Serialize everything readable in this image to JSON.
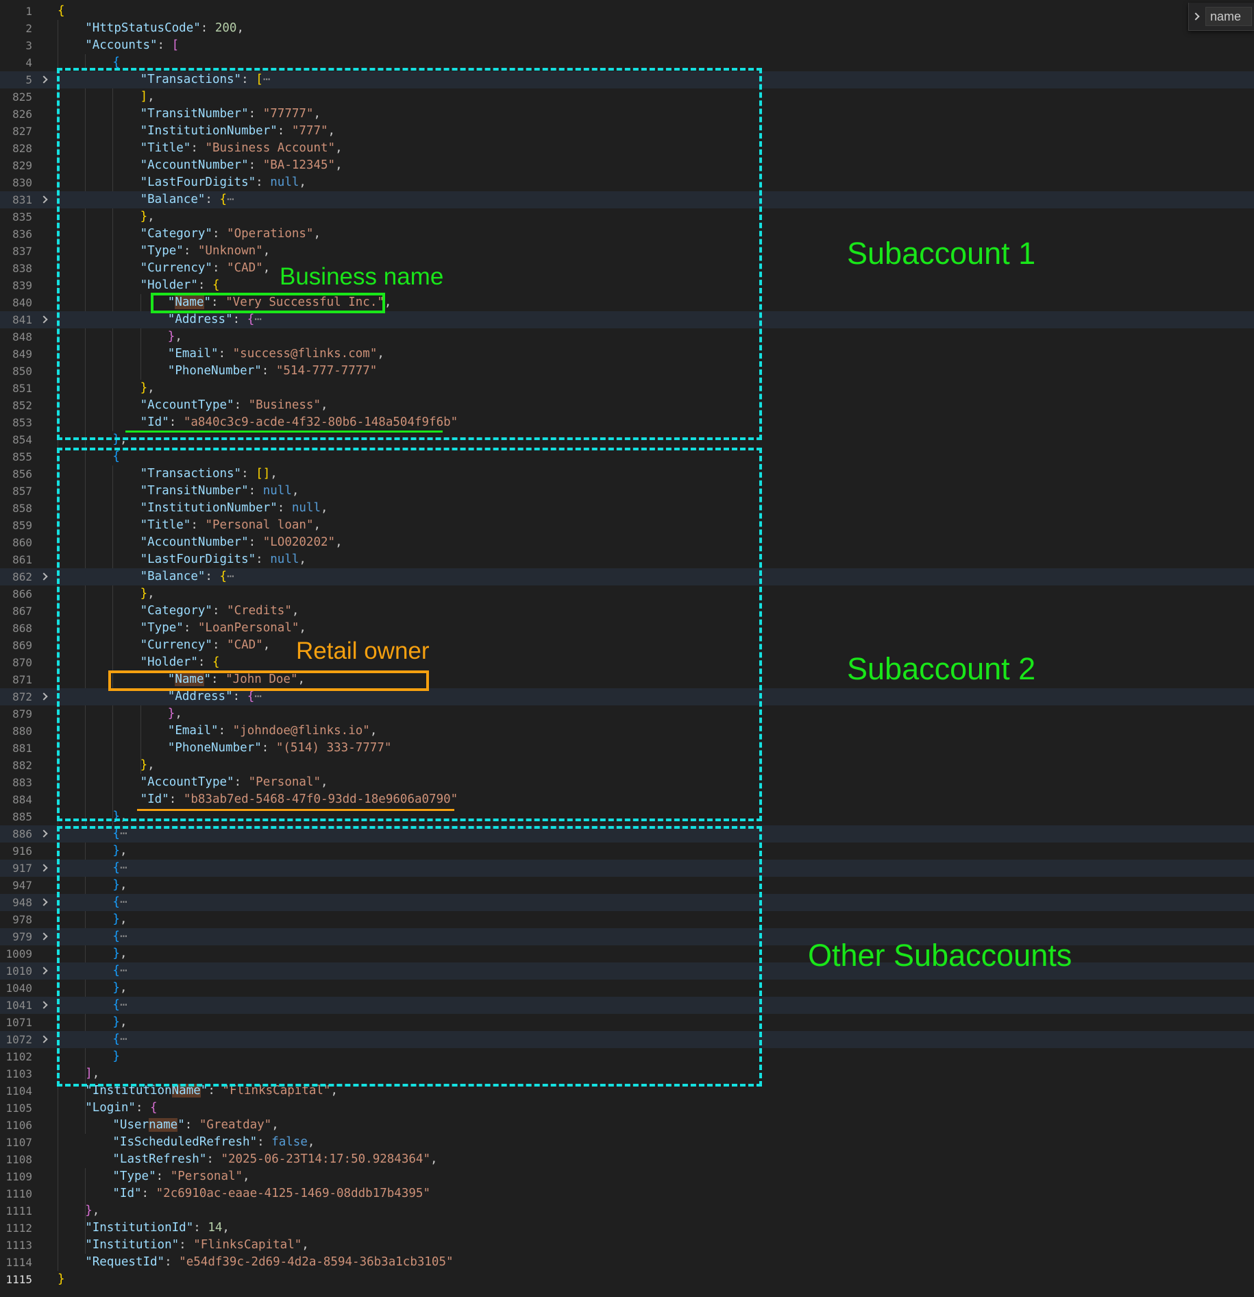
{
  "find_widget": {
    "query": "name"
  },
  "annotations": {
    "subaccount_1": "Subaccount 1",
    "subaccount_2": "Subaccount 2",
    "other_subaccounts": "Other Subaccounts",
    "business_name": "Business name",
    "retail_owner": "Retail owner"
  },
  "annotation_colors": {
    "green": "#19e619",
    "orange": "#f5a010",
    "cyan_dashed": "#14e0e0"
  },
  "current_line": "1115",
  "lines": [
    {
      "n": "1",
      "ind": 0,
      "t": [
        [
          "{",
          "br1"
        ]
      ]
    },
    {
      "n": "2",
      "ind": 1,
      "t": [
        [
          "\"HttpStatusCode\"",
          "k"
        ],
        [
          ": ",
          "p"
        ],
        [
          "200",
          "n"
        ],
        [
          ",",
          "p"
        ]
      ]
    },
    {
      "n": "3",
      "ind": 1,
      "t": [
        [
          "\"Accounts\"",
          "k"
        ],
        [
          ": ",
          "p"
        ],
        [
          "[",
          "br2"
        ]
      ]
    },
    {
      "n": "4",
      "ind": 2,
      "t": [
        [
          "{",
          "br3"
        ]
      ]
    },
    {
      "n": "5",
      "ind": 3,
      "f": true,
      "t": [
        [
          "\"Transactions\"",
          "k"
        ],
        [
          ": ",
          "p"
        ],
        [
          "[",
          "br1"
        ],
        [
          "⋯",
          "e"
        ]
      ]
    },
    {
      "n": "825",
      "ind": 3,
      "t": [
        [
          "]",
          "br1"
        ],
        [
          ",",
          "p"
        ]
      ]
    },
    {
      "n": "826",
      "ind": 3,
      "t": [
        [
          "\"TransitNumber\"",
          "k"
        ],
        [
          ": ",
          "p"
        ],
        [
          "\"77777\"",
          "s"
        ],
        [
          ",",
          "p"
        ]
      ]
    },
    {
      "n": "827",
      "ind": 3,
      "t": [
        [
          "\"InstitutionNumber\"",
          "k"
        ],
        [
          ": ",
          "p"
        ],
        [
          "\"777\"",
          "s"
        ],
        [
          ",",
          "p"
        ]
      ]
    },
    {
      "n": "828",
      "ind": 3,
      "t": [
        [
          "\"Title\"",
          "k"
        ],
        [
          ": ",
          "p"
        ],
        [
          "\"Business Account\"",
          "s"
        ],
        [
          ",",
          "p"
        ]
      ]
    },
    {
      "n": "829",
      "ind": 3,
      "t": [
        [
          "\"AccountNumber\"",
          "k"
        ],
        [
          ": ",
          "p"
        ],
        [
          "\"BA-12345\"",
          "s"
        ],
        [
          ",",
          "p"
        ]
      ]
    },
    {
      "n": "830",
      "ind": 3,
      "t": [
        [
          "\"LastFourDigits\"",
          "k"
        ],
        [
          ": ",
          "p"
        ],
        [
          "null",
          "b"
        ],
        [
          ",",
          "p"
        ]
      ]
    },
    {
      "n": "831",
      "ind": 3,
      "f": true,
      "t": [
        [
          "\"Balance\"",
          "k"
        ],
        [
          ": ",
          "p"
        ],
        [
          "{",
          "br1"
        ],
        [
          "⋯",
          "e"
        ]
      ]
    },
    {
      "n": "835",
      "ind": 3,
      "t": [
        [
          "}",
          "br1"
        ],
        [
          ",",
          "p"
        ]
      ]
    },
    {
      "n": "836",
      "ind": 3,
      "t": [
        [
          "\"Category\"",
          "k"
        ],
        [
          ": ",
          "p"
        ],
        [
          "\"Operations\"",
          "s"
        ],
        [
          ",",
          "p"
        ]
      ]
    },
    {
      "n": "837",
      "ind": 3,
      "t": [
        [
          "\"Type\"",
          "k"
        ],
        [
          ": ",
          "p"
        ],
        [
          "\"Unknown\"",
          "s"
        ],
        [
          ",",
          "p"
        ]
      ]
    },
    {
      "n": "838",
      "ind": 3,
      "t": [
        [
          "\"Currency\"",
          "k"
        ],
        [
          ": ",
          "p"
        ],
        [
          "\"CAD\"",
          "s"
        ],
        [
          ",",
          "p"
        ]
      ]
    },
    {
      "n": "839",
      "ind": 3,
      "t": [
        [
          "\"Holder\"",
          "k"
        ],
        [
          ": ",
          "p"
        ],
        [
          "{",
          "br1"
        ]
      ]
    },
    {
      "n": "840",
      "ind": 4,
      "t": [
        [
          "\"",
          "k"
        ],
        [
          "Name",
          "kh"
        ],
        [
          "\"",
          "k"
        ],
        [
          ": ",
          "p"
        ],
        [
          "\"Very Successful Inc.\"",
          "s"
        ],
        [
          ",",
          "p"
        ]
      ]
    },
    {
      "n": "841",
      "ind": 4,
      "f": true,
      "t": [
        [
          "\"Address\"",
          "k"
        ],
        [
          ": ",
          "p"
        ],
        [
          "{",
          "br2"
        ],
        [
          "⋯",
          "e"
        ]
      ]
    },
    {
      "n": "848",
      "ind": 4,
      "t": [
        [
          "}",
          "br2"
        ],
        [
          ",",
          "p"
        ]
      ]
    },
    {
      "n": "849",
      "ind": 4,
      "t": [
        [
          "\"Email\"",
          "k"
        ],
        [
          ": ",
          "p"
        ],
        [
          "\"success@flinks.com\"",
          "s"
        ],
        [
          ",",
          "p"
        ]
      ]
    },
    {
      "n": "850",
      "ind": 4,
      "t": [
        [
          "\"PhoneNumber\"",
          "k"
        ],
        [
          ": ",
          "p"
        ],
        [
          "\"514-777-7777\"",
          "s"
        ]
      ]
    },
    {
      "n": "851",
      "ind": 3,
      "t": [
        [
          "}",
          "br1"
        ],
        [
          ",",
          "p"
        ]
      ]
    },
    {
      "n": "852",
      "ind": 3,
      "t": [
        [
          "\"AccountType\"",
          "k"
        ],
        [
          ": ",
          "p"
        ],
        [
          "\"Business\"",
          "s"
        ],
        [
          ",",
          "p"
        ]
      ]
    },
    {
      "n": "853",
      "ind": 3,
      "t": [
        [
          "\"Id\"",
          "k"
        ],
        [
          ": ",
          "p"
        ],
        [
          "\"a840c3c9-acde-4f32-80b6-148a504f9f6b\"",
          "s"
        ]
      ]
    },
    {
      "n": "854",
      "ind": 2,
      "t": [
        [
          "}",
          "br3"
        ],
        [
          ",",
          "p"
        ]
      ]
    },
    {
      "n": "855",
      "ind": 2,
      "t": [
        [
          "{",
          "br3"
        ]
      ]
    },
    {
      "n": "856",
      "ind": 3,
      "t": [
        [
          "\"Transactions\"",
          "k"
        ],
        [
          ": ",
          "p"
        ],
        [
          "[]",
          "br1"
        ],
        [
          ",",
          "p"
        ]
      ]
    },
    {
      "n": "857",
      "ind": 3,
      "t": [
        [
          "\"TransitNumber\"",
          "k"
        ],
        [
          ": ",
          "p"
        ],
        [
          "null",
          "b"
        ],
        [
          ",",
          "p"
        ]
      ]
    },
    {
      "n": "858",
      "ind": 3,
      "t": [
        [
          "\"InstitutionNumber\"",
          "k"
        ],
        [
          ": ",
          "p"
        ],
        [
          "null",
          "b"
        ],
        [
          ",",
          "p"
        ]
      ]
    },
    {
      "n": "859",
      "ind": 3,
      "t": [
        [
          "\"Title\"",
          "k"
        ],
        [
          ": ",
          "p"
        ],
        [
          "\"Personal loan\"",
          "s"
        ],
        [
          ",",
          "p"
        ]
      ]
    },
    {
      "n": "860",
      "ind": 3,
      "t": [
        [
          "\"AccountNumber\"",
          "k"
        ],
        [
          ": ",
          "p"
        ],
        [
          "\"LO020202\"",
          "s"
        ],
        [
          ",",
          "p"
        ]
      ]
    },
    {
      "n": "861",
      "ind": 3,
      "t": [
        [
          "\"LastFourDigits\"",
          "k"
        ],
        [
          ": ",
          "p"
        ],
        [
          "null",
          "b"
        ],
        [
          ",",
          "p"
        ]
      ]
    },
    {
      "n": "862",
      "ind": 3,
      "f": true,
      "t": [
        [
          "\"Balance\"",
          "k"
        ],
        [
          ": ",
          "p"
        ],
        [
          "{",
          "br1"
        ],
        [
          "⋯",
          "e"
        ]
      ]
    },
    {
      "n": "866",
      "ind": 3,
      "t": [
        [
          "}",
          "br1"
        ],
        [
          ",",
          "p"
        ]
      ]
    },
    {
      "n": "867",
      "ind": 3,
      "t": [
        [
          "\"Category\"",
          "k"
        ],
        [
          ": ",
          "p"
        ],
        [
          "\"Credits\"",
          "s"
        ],
        [
          ",",
          "p"
        ]
      ]
    },
    {
      "n": "868",
      "ind": 3,
      "t": [
        [
          "\"Type\"",
          "k"
        ],
        [
          ": ",
          "p"
        ],
        [
          "\"LoanPersonal\"",
          "s"
        ],
        [
          ",",
          "p"
        ]
      ]
    },
    {
      "n": "869",
      "ind": 3,
      "t": [
        [
          "\"Currency\"",
          "k"
        ],
        [
          ": ",
          "p"
        ],
        [
          "\"CAD\"",
          "s"
        ],
        [
          ",",
          "p"
        ]
      ]
    },
    {
      "n": "870",
      "ind": 3,
      "t": [
        [
          "\"Holder\"",
          "k"
        ],
        [
          ": ",
          "p"
        ],
        [
          "{",
          "br1"
        ]
      ]
    },
    {
      "n": "871",
      "ind": 4,
      "t": [
        [
          "\"",
          "k"
        ],
        [
          "Name",
          "kh"
        ],
        [
          "\"",
          "k"
        ],
        [
          ": ",
          "p"
        ],
        [
          "\"John Doe\"",
          "s"
        ],
        [
          ",",
          "p"
        ]
      ]
    },
    {
      "n": "872",
      "ind": 4,
      "f": true,
      "t": [
        [
          "\"Address\"",
          "k"
        ],
        [
          ": ",
          "p"
        ],
        [
          "{",
          "br2"
        ],
        [
          "⋯",
          "e"
        ]
      ]
    },
    {
      "n": "879",
      "ind": 4,
      "t": [
        [
          "}",
          "br2"
        ],
        [
          ",",
          "p"
        ]
      ]
    },
    {
      "n": "880",
      "ind": 4,
      "t": [
        [
          "\"Email\"",
          "k"
        ],
        [
          ": ",
          "p"
        ],
        [
          "\"johndoe@flinks.io\"",
          "s"
        ],
        [
          ",",
          "p"
        ]
      ]
    },
    {
      "n": "881",
      "ind": 4,
      "t": [
        [
          "\"PhoneNumber\"",
          "k"
        ],
        [
          ": ",
          "p"
        ],
        [
          "\"(514) 333-7777\"",
          "s"
        ]
      ]
    },
    {
      "n": "882",
      "ind": 3,
      "t": [
        [
          "}",
          "br1"
        ],
        [
          ",",
          "p"
        ]
      ]
    },
    {
      "n": "883",
      "ind": 3,
      "t": [
        [
          "\"AccountType\"",
          "k"
        ],
        [
          ": ",
          "p"
        ],
        [
          "\"Personal\"",
          "s"
        ],
        [
          ",",
          "p"
        ]
      ]
    },
    {
      "n": "884",
      "ind": 3,
      "t": [
        [
          "\"Id\"",
          "k"
        ],
        [
          ": ",
          "p"
        ],
        [
          "\"b83ab7ed-5468-47f0-93dd-18e9606a0790\"",
          "s"
        ]
      ]
    },
    {
      "n": "885",
      "ind": 2,
      "t": [
        [
          "}",
          "br3"
        ],
        [
          ",",
          "p"
        ]
      ]
    },
    {
      "n": "886",
      "ind": 2,
      "f": true,
      "t": [
        [
          "{",
          "br3"
        ],
        [
          "⋯",
          "e"
        ]
      ]
    },
    {
      "n": "916",
      "ind": 2,
      "t": [
        [
          "}",
          "br3"
        ],
        [
          ",",
          "p"
        ]
      ]
    },
    {
      "n": "917",
      "ind": 2,
      "f": true,
      "t": [
        [
          "{",
          "br3"
        ],
        [
          "⋯",
          "e"
        ]
      ]
    },
    {
      "n": "947",
      "ind": 2,
      "t": [
        [
          "}",
          "br3"
        ],
        [
          ",",
          "p"
        ]
      ]
    },
    {
      "n": "948",
      "ind": 2,
      "f": true,
      "t": [
        [
          "{",
          "br3"
        ],
        [
          "⋯",
          "e"
        ]
      ]
    },
    {
      "n": "978",
      "ind": 2,
      "t": [
        [
          "}",
          "br3"
        ],
        [
          ",",
          "p"
        ]
      ]
    },
    {
      "n": "979",
      "ind": 2,
      "f": true,
      "t": [
        [
          "{",
          "br3"
        ],
        [
          "⋯",
          "e"
        ]
      ]
    },
    {
      "n": "1009",
      "ind": 2,
      "t": [
        [
          "}",
          "br3"
        ],
        [
          ",",
          "p"
        ]
      ]
    },
    {
      "n": "1010",
      "ind": 2,
      "f": true,
      "t": [
        [
          "{",
          "br3"
        ],
        [
          "⋯",
          "e"
        ]
      ]
    },
    {
      "n": "1040",
      "ind": 2,
      "t": [
        [
          "}",
          "br3"
        ],
        [
          ",",
          "p"
        ]
      ]
    },
    {
      "n": "1041",
      "ind": 2,
      "f": true,
      "t": [
        [
          "{",
          "br3"
        ],
        [
          "⋯",
          "e"
        ]
      ]
    },
    {
      "n": "1071",
      "ind": 2,
      "t": [
        [
          "}",
          "br3"
        ],
        [
          ",",
          "p"
        ]
      ]
    },
    {
      "n": "1072",
      "ind": 2,
      "f": true,
      "t": [
        [
          "{",
          "br3"
        ],
        [
          "⋯",
          "e"
        ]
      ]
    },
    {
      "n": "1102",
      "ind": 2,
      "t": [
        [
          "}",
          "br3"
        ]
      ]
    },
    {
      "n": "1103",
      "ind": 1,
      "t": [
        [
          "]",
          "br2"
        ],
        [
          ",",
          "p"
        ]
      ]
    },
    {
      "n": "1104",
      "ind": 1,
      "t": [
        [
          "\"Institution",
          "k"
        ],
        [
          "Name",
          "kh"
        ],
        [
          "\"",
          "k"
        ],
        [
          ": ",
          "p"
        ],
        [
          "\"FlinksCapital\"",
          "s"
        ],
        [
          ",",
          "p"
        ]
      ]
    },
    {
      "n": "1105",
      "ind": 1,
      "t": [
        [
          "\"Login\"",
          "k"
        ],
        [
          ": ",
          "p"
        ],
        [
          "{",
          "br2"
        ]
      ]
    },
    {
      "n": "1106",
      "ind": 2,
      "t": [
        [
          "\"User",
          "k"
        ],
        [
          "name",
          "kh"
        ],
        [
          "\"",
          "k"
        ],
        [
          ": ",
          "p"
        ],
        [
          "\"Greatday\"",
          "s"
        ],
        [
          ",",
          "p"
        ]
      ]
    },
    {
      "n": "1107",
      "ind": 2,
      "t": [
        [
          "\"IsScheduledRefresh\"",
          "k"
        ],
        [
          ": ",
          "p"
        ],
        [
          "false",
          "b"
        ],
        [
          ",",
          "p"
        ]
      ]
    },
    {
      "n": "1108",
      "ind": 2,
      "t": [
        [
          "\"LastRefresh\"",
          "k"
        ],
        [
          ": ",
          "p"
        ],
        [
          "\"2025-06-23T14:17:50.9284364\"",
          "s"
        ],
        [
          ",",
          "p"
        ]
      ]
    },
    {
      "n": "1109",
      "ind": 2,
      "t": [
        [
          "\"Type\"",
          "k"
        ],
        [
          ": ",
          "p"
        ],
        [
          "\"Personal\"",
          "s"
        ],
        [
          ",",
          "p"
        ]
      ]
    },
    {
      "n": "1110",
      "ind": 2,
      "t": [
        [
          "\"Id\"",
          "k"
        ],
        [
          ": ",
          "p"
        ],
        [
          "\"2c6910ac-eaae-4125-1469-08ddb17b4395\"",
          "s"
        ]
      ]
    },
    {
      "n": "1111",
      "ind": 1,
      "t": [
        [
          "}",
          "br2"
        ],
        [
          ",",
          "p"
        ]
      ]
    },
    {
      "n": "1112",
      "ind": 1,
      "t": [
        [
          "\"InstitutionId\"",
          "k"
        ],
        [
          ": ",
          "p"
        ],
        [
          "14",
          "n"
        ],
        [
          ",",
          "p"
        ]
      ]
    },
    {
      "n": "1113",
      "ind": 1,
      "t": [
        [
          "\"Institution\"",
          "k"
        ],
        [
          ": ",
          "p"
        ],
        [
          "\"FlinksCapital\"",
          "s"
        ],
        [
          ",",
          "p"
        ]
      ]
    },
    {
      "n": "1114",
      "ind": 1,
      "t": [
        [
          "\"RequestId\"",
          "k"
        ],
        [
          ": ",
          "p"
        ],
        [
          "\"e54df39c-2d69-4d2a-8594-36b3a1cb3105\"",
          "s"
        ]
      ]
    },
    {
      "n": "1115",
      "ind": 0,
      "t": [
        [
          "}",
          "br1"
        ]
      ]
    }
  ]
}
